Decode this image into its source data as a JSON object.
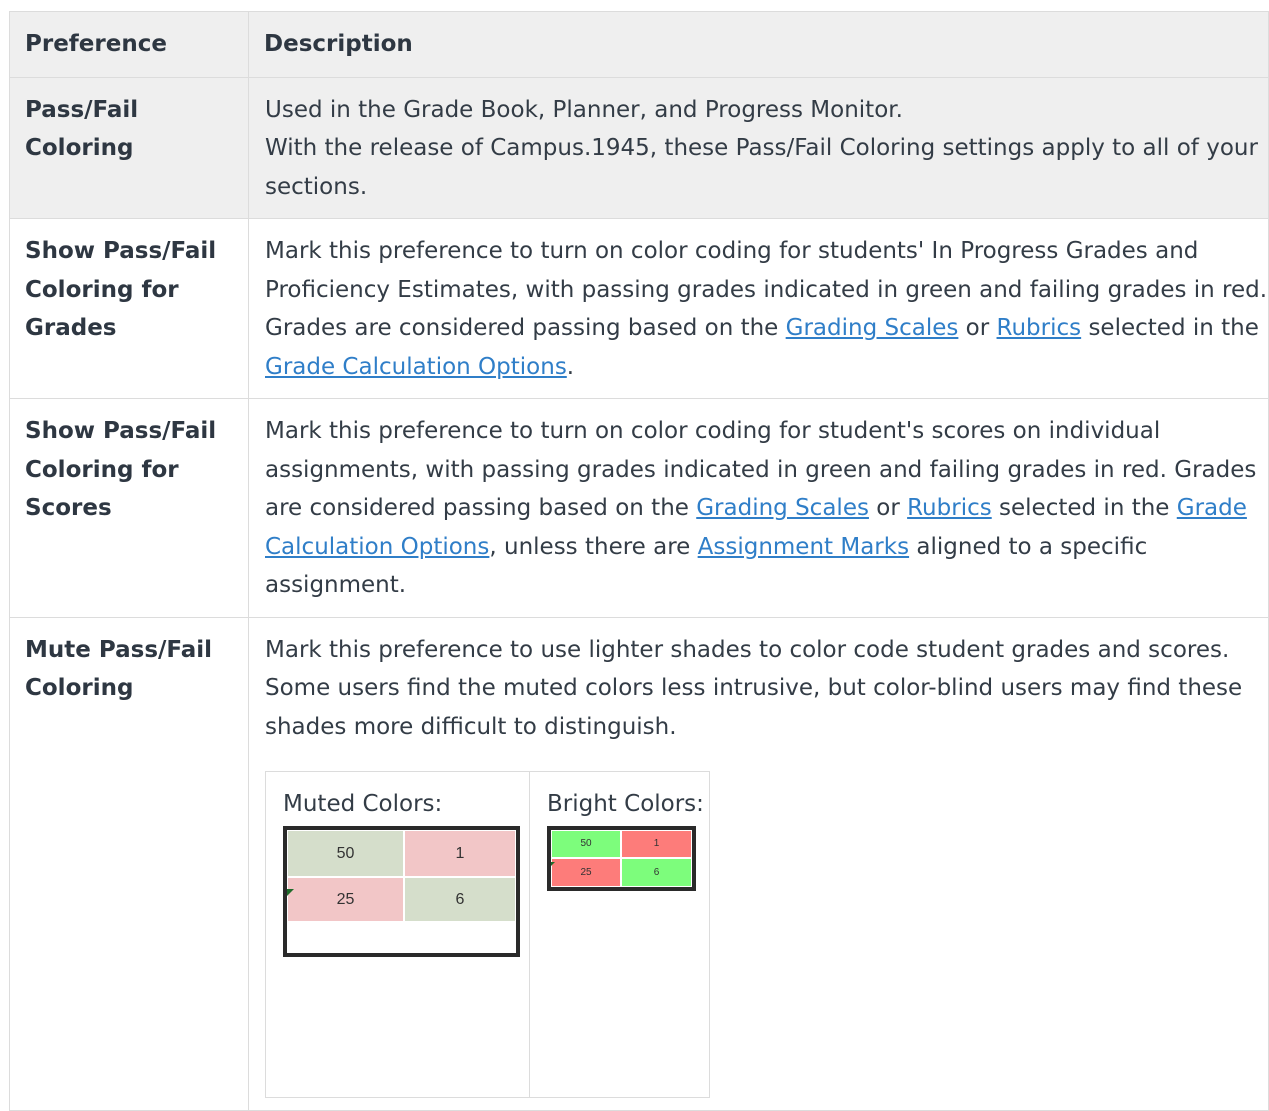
{
  "table": {
    "headers": {
      "preference": "Preference",
      "description": "Description"
    },
    "rows": [
      {
        "preference": "Pass/Fail Coloring",
        "description": [
          "Used in the Grade Book, Planner, and Progress Monitor.",
          "With the release of Campus.1945, these Pass/Fail Coloring settings apply to all of your sections."
        ]
      },
      {
        "preference": "Show Pass/Fail Coloring for Grades",
        "text1": "Mark this preference to turn on color coding for students' In Progress Grades and Proficiency Estimates, with passing grades indicated in green and failing grades in red. Grades are considered passing based on the ",
        "link1": "Grading Scales",
        "text2": " or ",
        "link2": "Rubrics",
        "text3": " selected in the ",
        "link3": "Grade Calculation Options",
        "text4": "."
      },
      {
        "preference": "Show Pass/Fail Coloring for Scores",
        "text1": "Mark this preference to turn on color coding for student's scores on individual assignments, with passing grades indicated in green and failing grades in red. Grades are considered passing based on the ",
        "link1": "Grading Scales",
        "text2": " or ",
        "link2": "Rubrics",
        "text3": " selected in the ",
        "link3": "Grade Calculation Options",
        "text4": ", unless there are ",
        "link4": "Assignment Marks",
        "text5": " aligned to a specific assignment."
      },
      {
        "preference": "Mute Pass/Fail Coloring",
        "description": "Mark this preference to use lighter shades to color code student grades and scores. Some users find the muted colors less intrusive, but color-blind users may find these shades more difficult to distinguish.",
        "examples": {
          "muted_label": "Muted Colors:",
          "bright_label": "Bright Colors:",
          "values": [
            "50",
            "1",
            "25",
            "6"
          ]
        }
      }
    ]
  },
  "colors": {
    "muted_pass": "#d5decb",
    "muted_fail": "#f2c6c7",
    "bright_pass": "#7dfd7c",
    "bright_fail": "#fd7c7a",
    "link": "#2f7ec8"
  }
}
